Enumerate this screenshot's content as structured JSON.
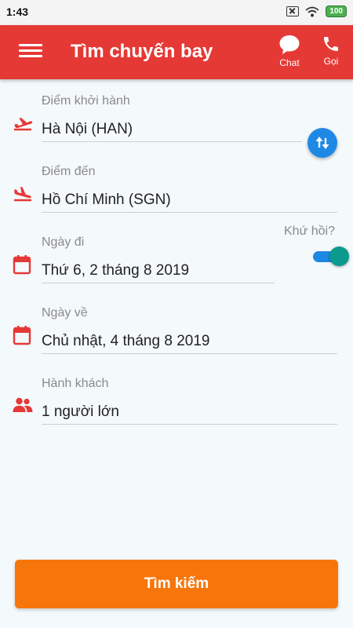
{
  "status_bar": {
    "time": "1:43",
    "battery": "100",
    "icons": [
      "sim-off-icon",
      "wifi-icon",
      "battery-icon"
    ]
  },
  "app_bar": {
    "title": "Tìm chuyến bay",
    "chat_label": "Chat",
    "call_label": "Gọi",
    "color": "#e53935"
  },
  "form": {
    "origin": {
      "label": "Điểm khởi hành",
      "value": "Hà Nội (HAN)",
      "icon": "plane-takeoff-icon"
    },
    "destination": {
      "label": "Điểm đến",
      "value": "Hồ Chí Minh (SGN)",
      "icon": "plane-landing-icon"
    },
    "depart_date": {
      "label": "Ngày đi",
      "value": "Thứ 6, 2 tháng 8 2019",
      "icon": "calendar-icon"
    },
    "return_date": {
      "label": "Ngày về",
      "value": "Chủ nhật, 4 tháng 8 2019",
      "icon": "calendar-icon"
    },
    "passengers": {
      "label": "Hành khách",
      "value": "1 người lớn",
      "icon": "people-icon"
    },
    "round_trip": {
      "label": "Khứ hồi?",
      "checked": true
    }
  },
  "search_button": {
    "label": "Tìm kiếm",
    "color": "#f7760b"
  },
  "colors": {
    "accent_red": "#e53935",
    "swap_blue": "#1e88e5",
    "toggle_thumb": "#0b9a8d",
    "background": "#f4f9fc"
  }
}
